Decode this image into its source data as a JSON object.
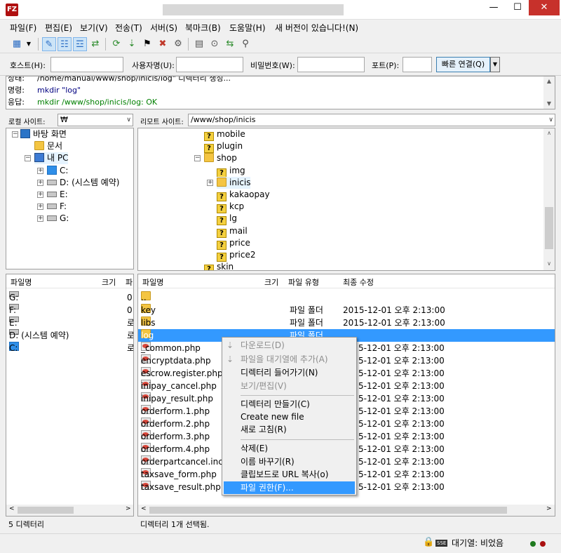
{
  "app": {
    "icon_label": "FZ",
    "window_buttons": [
      "—",
      "☐",
      "✕"
    ]
  },
  "menu": [
    {
      "label": "파일(F)"
    },
    {
      "label": "편집(E)"
    },
    {
      "label": "보기(V)"
    },
    {
      "label": "전송(T)"
    },
    {
      "label": "서버(S)"
    },
    {
      "label": "북마크(B)"
    },
    {
      "label": "도움말(H)"
    },
    {
      "label": "새 버전이 있습니다!(N)"
    }
  ],
  "toolbar": {
    "icons": [
      "site-manager-icon",
      "dropdown-arrow-icon",
      "message-log-icon",
      "local-tree-icon",
      "remote-tree-icon",
      "transfer-queue-icon",
      "refresh-icon",
      "process-queue-icon",
      "cancel-icon",
      "disconnect-icon",
      "reconnect-icon",
      "filter-icon",
      "compare-icon",
      "sync-browse-icon",
      "search-icon"
    ]
  },
  "quickconnect": {
    "host_label": "호스트(H):",
    "user_label": "사용자명(U):",
    "pass_label": "비밀번호(W):",
    "port_label": "포트(P):",
    "connect_label": "빠른 연결(Q)",
    "host_value": "",
    "user_value": "",
    "pass_value": "",
    "port_value": ""
  },
  "log": [
    {
      "kind": "상태:",
      "text": "/home/manual/www/shop/inicis/log\" 디렉터리 생성...",
      "color": "#000000"
    },
    {
      "kind": "명령:",
      "text": "mkdir \"log\"",
      "color": "#000080"
    },
    {
      "kind": "응답:",
      "text": "mkdir  /www/shop/inicis/log: OK",
      "color": "#008000"
    }
  ],
  "local": {
    "site_label": "로컬 사이트:",
    "path": "₩",
    "tree": [
      {
        "label": "바탕 화면",
        "icon": "desktop-icon"
      },
      {
        "label": "문서",
        "icon": "folder-icon"
      },
      {
        "label": "내 PC",
        "icon": "pc-icon"
      },
      {
        "label": "C:",
        "icon": "windows-drive-icon"
      },
      {
        "label": "D: (시스템 예약)",
        "icon": "drive-icon"
      },
      {
        "label": "E:",
        "icon": "drive-icon"
      },
      {
        "label": "F:",
        "icon": "drive-icon"
      },
      {
        "label": "G:",
        "icon": "drive-icon"
      }
    ],
    "columns": {
      "name": "파일명",
      "size": "크기",
      "type": "파"
    },
    "files": [
      {
        "name": "G:",
        "type": "0",
        "icon": "drive-icon"
      },
      {
        "name": "F:",
        "type": "0",
        "icon": "drive-icon"
      },
      {
        "name": "E:",
        "type": "로",
        "icon": "drive-icon"
      },
      {
        "name": "D: (시스템 예약)",
        "type": "로",
        "icon": "drive-icon"
      },
      {
        "name": "C:",
        "type": "로",
        "icon": "windows-drive-icon"
      }
    ],
    "status": "5 디렉터리"
  },
  "remote": {
    "site_label": "리모트 사이트:",
    "path": "/www/shop/inicis",
    "tree": [
      {
        "label": "mobile",
        "icon": "unknown-folder-icon"
      },
      {
        "label": "plugin",
        "icon": "unknown-folder-icon"
      },
      {
        "label": "shop",
        "icon": "folder-icon"
      },
      {
        "label": "img",
        "icon": "unknown-folder-icon"
      },
      {
        "label": "inicis",
        "icon": "folder-icon"
      },
      {
        "label": "kakaopay",
        "icon": "unknown-folder-icon"
      },
      {
        "label": "kcp",
        "icon": "unknown-folder-icon"
      },
      {
        "label": "lg",
        "icon": "unknown-folder-icon"
      },
      {
        "label": "mail",
        "icon": "unknown-folder-icon"
      },
      {
        "label": "price",
        "icon": "unknown-folder-icon"
      },
      {
        "label": "price2",
        "icon": "unknown-folder-icon"
      },
      {
        "label": "skin",
        "icon": "unknown-folder-icon"
      }
    ],
    "columns": {
      "name": "파일명",
      "size": "크기",
      "type": "파일 유형",
      "modified": "최종 수정"
    },
    "files": [
      {
        "name": "..",
        "type": "",
        "modified": "",
        "icon": "folder-icon"
      },
      {
        "name": "key",
        "type": "파일 폴더",
        "modified": "2015-12-01 오후 2:13:00",
        "icon": "folder-icon"
      },
      {
        "name": "libs",
        "type": "파일 폴더",
        "modified": "2015-12-01 오후 2:13:00",
        "icon": "folder-icon"
      },
      {
        "name": "log",
        "type": "파일 폴더",
        "modified": "",
        "icon": "folder-icon"
      },
      {
        "name": "_common.php",
        "type": "",
        "modified": "5-12-01 오후 2:13:00",
        "icon": "php-file-icon"
      },
      {
        "name": "encryptdata.php",
        "type": "",
        "modified": "5-12-01 오후 2:13:00",
        "icon": "php-file-icon"
      },
      {
        "name": "escrow.register.php",
        "type": "",
        "modified": "5-12-01 오후 2:13:00",
        "icon": "php-file-icon"
      },
      {
        "name": "inipay_cancel.php",
        "type": "",
        "modified": "5-12-01 오후 2:13:00",
        "icon": "php-file-icon"
      },
      {
        "name": "inipay_result.php",
        "type": "",
        "modified": "5-12-01 오후 2:13:00",
        "icon": "php-file-icon"
      },
      {
        "name": "orderform.1.php",
        "type": "",
        "modified": "5-12-01 오후 2:13:00",
        "icon": "php-file-icon"
      },
      {
        "name": "orderform.2.php",
        "type": "",
        "modified": "5-12-01 오후 2:13:00",
        "icon": "php-file-icon"
      },
      {
        "name": "orderform.3.php",
        "type": "",
        "modified": "5-12-01 오후 2:13:00",
        "icon": "php-file-icon"
      },
      {
        "name": "orderform.4.php",
        "type": "",
        "modified": "5-12-01 오후 2:13:00",
        "icon": "php-file-icon"
      },
      {
        "name": "orderpartcancel.inc",
        "type": "",
        "modified": "5-12-01 오후 2:13:00",
        "icon": "php-file-icon"
      },
      {
        "name": "taxsave_form.php",
        "type": "",
        "modified": "5-12-01 오후 2:13:00",
        "icon": "php-file-icon"
      },
      {
        "name": "taxsave_result.php",
        "type": "",
        "modified": "5-12-01 오후 2:13:00",
        "icon": "php-file-icon"
      }
    ],
    "status": "디렉터리 1개 선택됨."
  },
  "context_menu": {
    "groups": [
      [
        {
          "label": "다운로드(D)",
          "disabled": true,
          "icon": "download-icon"
        },
        {
          "label": "파일을 대기열에 추가(A)",
          "disabled": true,
          "icon": "add-queue-icon"
        },
        {
          "label": "디렉터리 들어가기(N)",
          "disabled": false
        },
        {
          "label": "보기/편집(V)",
          "disabled": true
        }
      ],
      [
        {
          "label": "디렉터리 만들기(C)",
          "disabled": false
        },
        {
          "label": "Create new file",
          "disabled": false
        },
        {
          "label": "새로 고침(R)",
          "disabled": false
        }
      ],
      [
        {
          "label": "삭제(E)",
          "disabled": false
        },
        {
          "label": "이름 바꾸기(R)",
          "disabled": false
        },
        {
          "label": "클립보드로 URL 복사(o)",
          "disabled": false
        },
        {
          "label": "파일 권한(F)...",
          "disabled": false,
          "highlighted": true
        }
      ]
    ]
  },
  "statusbar": {
    "queue_text": "대기열: 비었음",
    "encrypt_badge": "SSE"
  },
  "colors": {
    "selection": "#3399ff",
    "close_button": "#c7312b",
    "log_command": "#000080",
    "log_response": "#008000"
  }
}
